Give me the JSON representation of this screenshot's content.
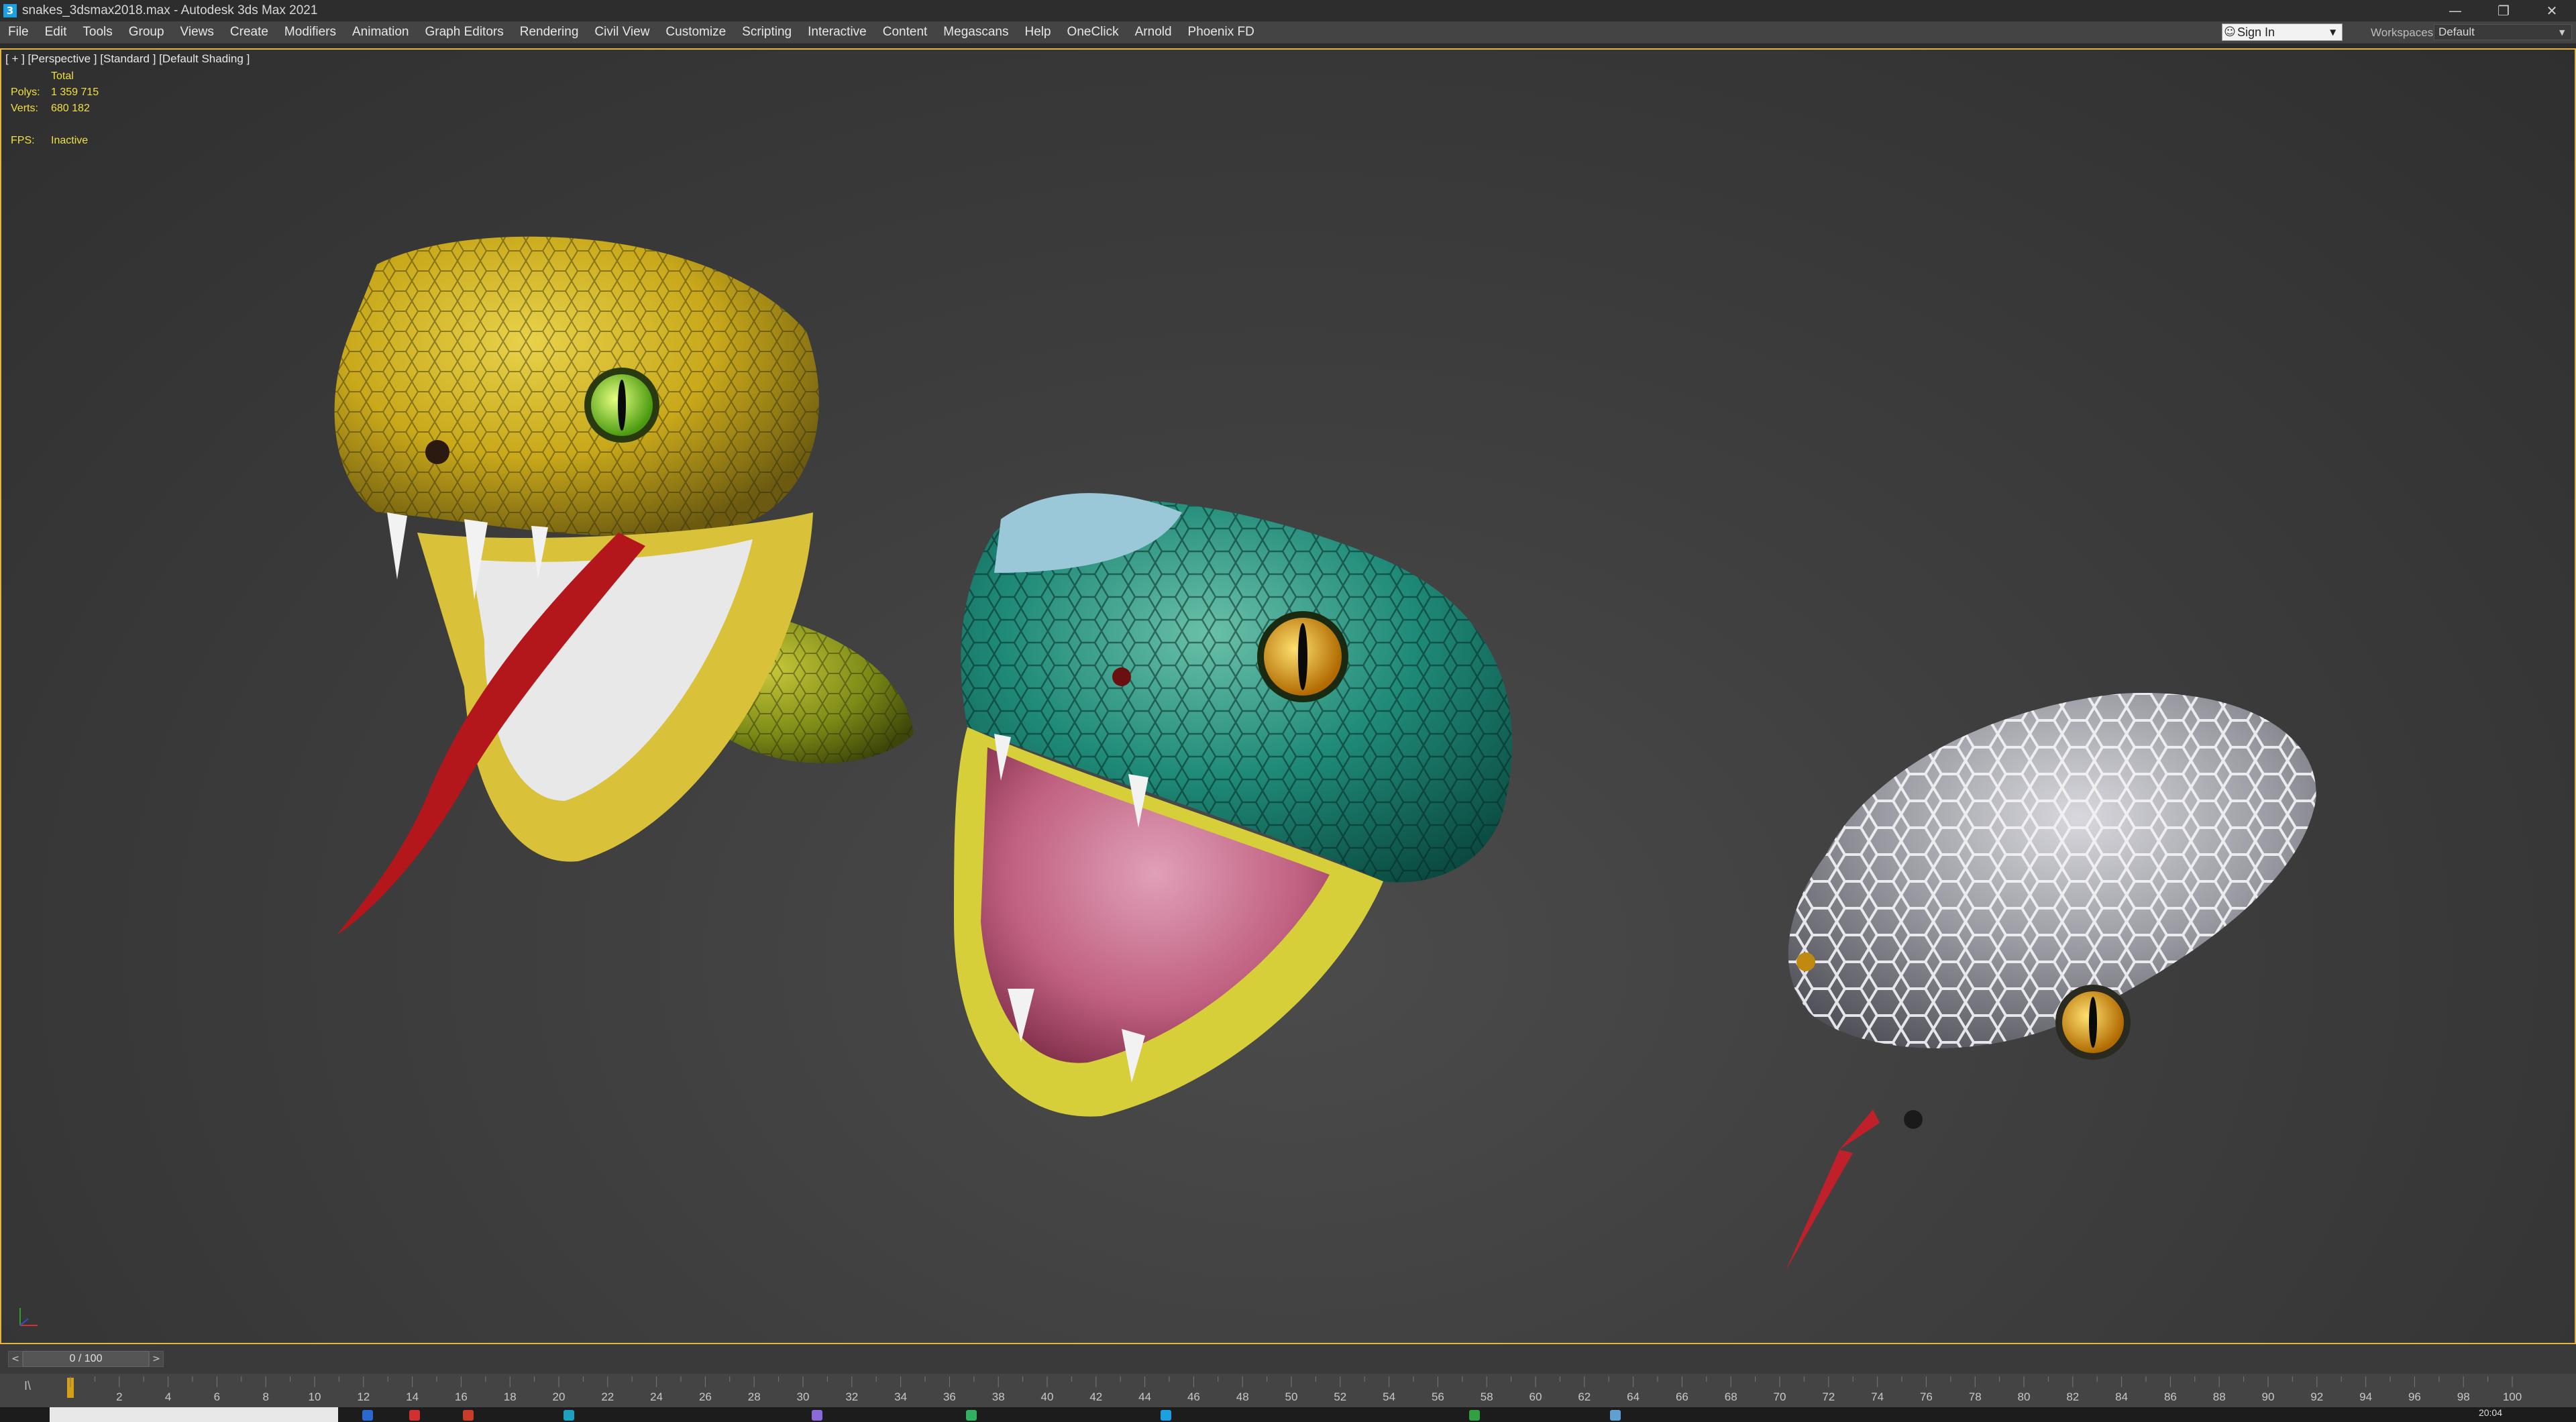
{
  "window": {
    "title": "snakes_3dsmax2018.max - Autodesk 3ds Max 2021",
    "app_icon_glyph": "3",
    "controls": {
      "minimize": "—",
      "restore": "❐",
      "close": "✕"
    }
  },
  "menubar": {
    "items": [
      "File",
      "Edit",
      "Tools",
      "Group",
      "Views",
      "Create",
      "Modifiers",
      "Animation",
      "Graph Editors",
      "Rendering",
      "Civil View",
      "Customize",
      "Scripting",
      "Interactive",
      "Content",
      "Megascans",
      "Help",
      "OneClick",
      "Arnold",
      "Phoenix FD"
    ],
    "sign_in": "Sign In",
    "workspaces_label": "Workspaces:",
    "workspaces_value": "Default"
  },
  "viewport": {
    "label": "[ + ] [Perspective ] [Standard ] [Default Shading ]",
    "stats": {
      "header": "Total",
      "polys_label": "Polys:",
      "polys": "1 359 715",
      "verts_label": "Verts:",
      "verts": "680 182",
      "fps_label": "FPS:",
      "fps": "Inactive"
    },
    "border_color": "#e0b640"
  },
  "timeslider": {
    "value": "0 / 100",
    "prev": "<",
    "next": ">"
  },
  "trackbar": {
    "key_icon": "I\\",
    "ticks": [
      2,
      4,
      6,
      8,
      10,
      12,
      14,
      16,
      18,
      20,
      22,
      24,
      26,
      28,
      30,
      32,
      34,
      36,
      38,
      40,
      42,
      44,
      46,
      48,
      50,
      52,
      54,
      56,
      58,
      60,
      62,
      64,
      66,
      68,
      70,
      72,
      74,
      76,
      78,
      80,
      82,
      84,
      86,
      88,
      90,
      92,
      94,
      96,
      98,
      100
    ],
    "current_frame": 0,
    "total_frames": 100
  },
  "taskbar": {
    "clock": "20:04"
  },
  "colors": {
    "accent": "#e0b640",
    "stats_text": "#f0e040",
    "menubar_bg": "#444444"
  }
}
